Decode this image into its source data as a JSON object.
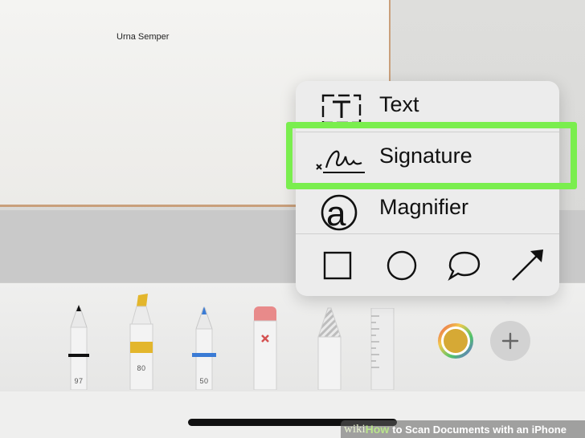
{
  "document": {
    "signer_name": "Urna Semper"
  },
  "markup_menu": {
    "items": [
      {
        "label": "Text",
        "icon": "text-box-icon"
      },
      {
        "label": "Signature",
        "icon": "signature-icon"
      },
      {
        "label": "Magnifier",
        "icon": "magnifier-icon"
      }
    ],
    "shapes": [
      "square-shape-icon",
      "circle-shape-icon",
      "speech-bubble-shape-icon",
      "arrow-shape-icon"
    ],
    "highlighted_item": "Signature",
    "highlight_color": "#7aee4e"
  },
  "toolbar": {
    "tools": [
      {
        "name": "pen",
        "size": "97",
        "color": "#111111"
      },
      {
        "name": "highlighter",
        "size": "80",
        "color": "#e3b62c"
      },
      {
        "name": "pencil",
        "size": "50",
        "color": "#3a7bd5"
      },
      {
        "name": "eraser",
        "size": "",
        "color": "#e88a8a"
      },
      {
        "name": "lasso",
        "size": "",
        "color": "#bbbbbb"
      },
      {
        "name": "ruler",
        "size": "",
        "color": "#cccccc"
      }
    ],
    "current_color": "#d6a935",
    "add_icon": "plus-icon"
  },
  "footer": {
    "wiki": "wiki",
    "how": "How",
    "title": "to Scan Documents with an iPhone"
  }
}
